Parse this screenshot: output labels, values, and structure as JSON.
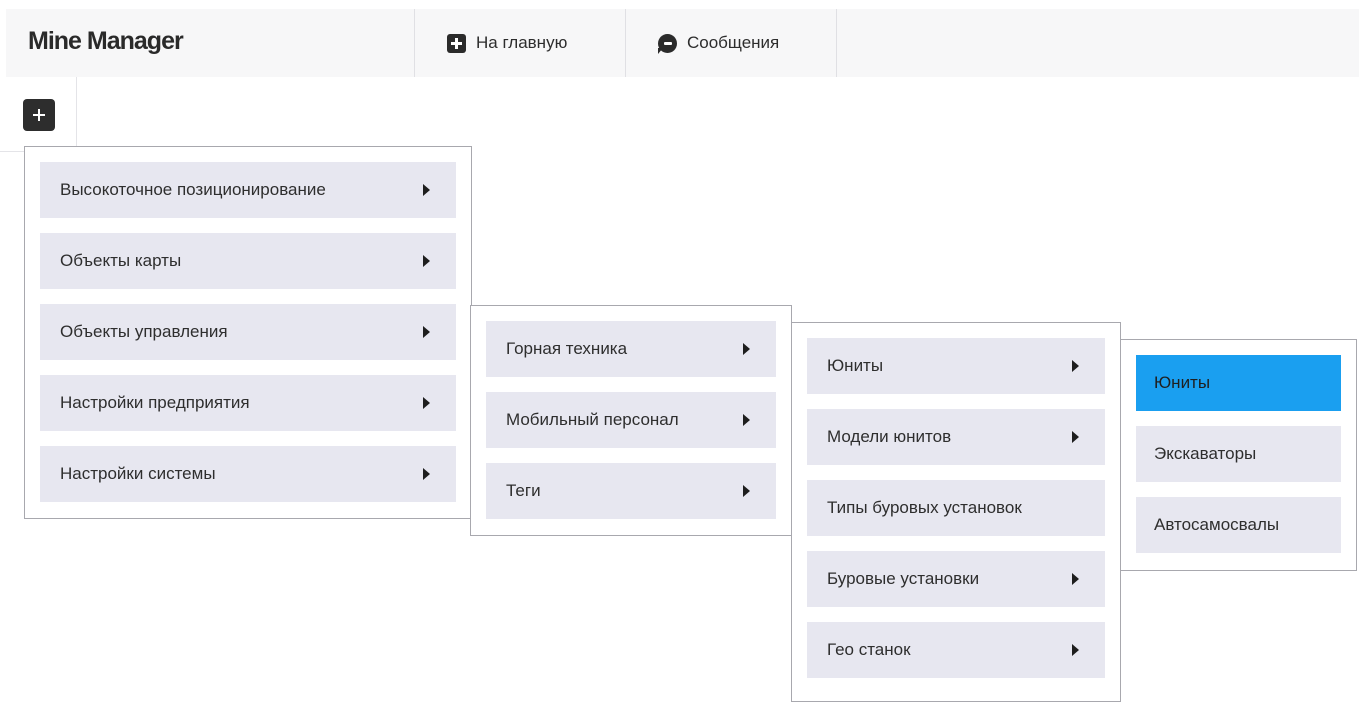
{
  "app": {
    "title": "Mine Manager"
  },
  "nav": {
    "home_label": "На главную",
    "messages_label": "Сообщения"
  },
  "menus": {
    "level1": [
      {
        "label": "Высокоточное позиционирование",
        "submenu": true
      },
      {
        "label": "Объекты карты",
        "submenu": true
      },
      {
        "label": "Объекты управления",
        "submenu": true
      },
      {
        "label": "Настройки предприятия",
        "submenu": true
      },
      {
        "label": "Настройки системы",
        "submenu": true
      }
    ],
    "level2": [
      {
        "label": "Горная техника",
        "submenu": true
      },
      {
        "label": "Мобильный персонал",
        "submenu": true
      },
      {
        "label": "Теги",
        "submenu": true
      }
    ],
    "level3": [
      {
        "label": "Юниты",
        "submenu": true
      },
      {
        "label": "Модели юнитов",
        "submenu": true
      },
      {
        "label": "Типы буровых установок",
        "submenu": false
      },
      {
        "label": "Буровые установки",
        "submenu": true
      },
      {
        "label": "Гео станок",
        "submenu": true
      }
    ],
    "level4": [
      {
        "label": "Юниты",
        "submenu": false,
        "active": true
      },
      {
        "label": "Экскаваторы",
        "submenu": false
      },
      {
        "label": "Автосамосвалы",
        "submenu": false
      }
    ]
  },
  "colors": {
    "active_item": "#1a9ff0",
    "menu_item_bg": "#e7e7f0",
    "topbar_bg": "#f7f7f8"
  }
}
